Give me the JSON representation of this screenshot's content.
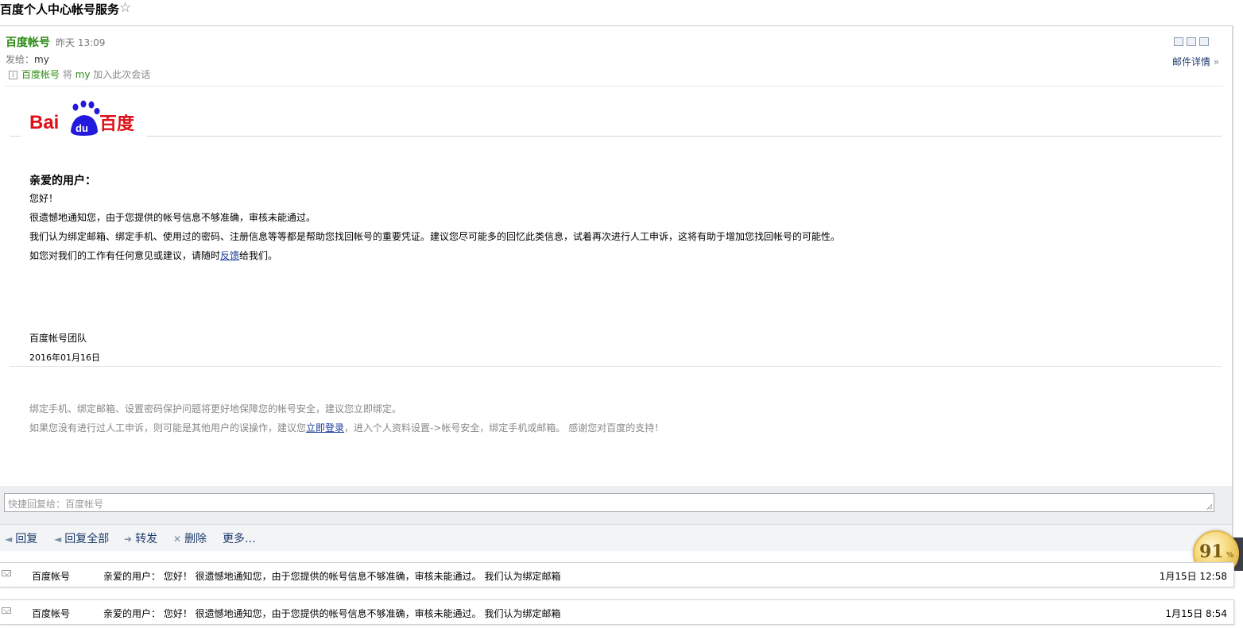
{
  "subject": "百度个人中心帐号服务",
  "header": {
    "sender": "百度帐号",
    "time": "昨天 13:09",
    "to_label": "发给：",
    "to_value": "my",
    "join_sender": "百度帐号",
    "join_mid": " 将 ",
    "join_user": "my",
    "join_suffix": " 加入此次会话",
    "details": "邮件详情"
  },
  "logo": {
    "text_bai": "Bai",
    "text_du": "du",
    "text_cn": "百度"
  },
  "body": {
    "greeting": "亲爱的用户：",
    "hello": "您好！",
    "line1": "很遗憾地通知您，由于您提供的帐号信息不够准确，审核未能通过。",
    "line2": "我们认为绑定邮箱、绑定手机、使用过的密码、注册信息等等都是帮助您找回帐号的重要凭证。建议您尽可能多的回忆此类信息，试着再次进行人工申诉，这将有助于增加您找回帐号的可能性。",
    "line3_pre": "如您对我们的工作有任何意见或建议，请随时",
    "line3_link": "反馈",
    "line3_post": "给我们。",
    "team": "百度帐号团队",
    "date": "2016年01月16日"
  },
  "footer": {
    "line1": "绑定手机、绑定邮箱、设置密码保护问题将更好地保障您的帐号安全，建议您立即绑定。",
    "line2_pre": "如果您没有进行过人工申诉，则可能是其他用户的误操作，建议您",
    "line2_link": "立即登录",
    "line2_post": "，进入个人资料设置->帐号安全，绑定手机或邮箱。 感谢您对百度的支持！"
  },
  "reply": {
    "placeholder": "快捷回复给：百度帐号"
  },
  "actions": {
    "reply": "回复",
    "reply_all": "回复全部",
    "forward": "转发",
    "delete": "删除",
    "more": "更多…"
  },
  "badge": {
    "value": "91",
    "unit": "%"
  },
  "thread": [
    {
      "sender": "百度帐号",
      "snippet": "亲爱的用户： 您好！ 很遗憾地通知您，由于您提供的帐号信息不够准确，审核未能通过。 我们认为绑定邮箱",
      "time": "1月15日 12:58"
    },
    {
      "sender": "百度帐号",
      "snippet": "亲爱的用户： 您好！ 很遗憾地通知您，由于您提供的帐号信息不够准确，审核未能通过。 我们认为绑定邮箱",
      "time": "1月15日 8:54"
    }
  ],
  "colors": {
    "sender_green": "#2c8a14",
    "baidu_red": "#de0f17",
    "baidu_blue": "#2319dc",
    "link_blue": "#1a3d9c"
  }
}
